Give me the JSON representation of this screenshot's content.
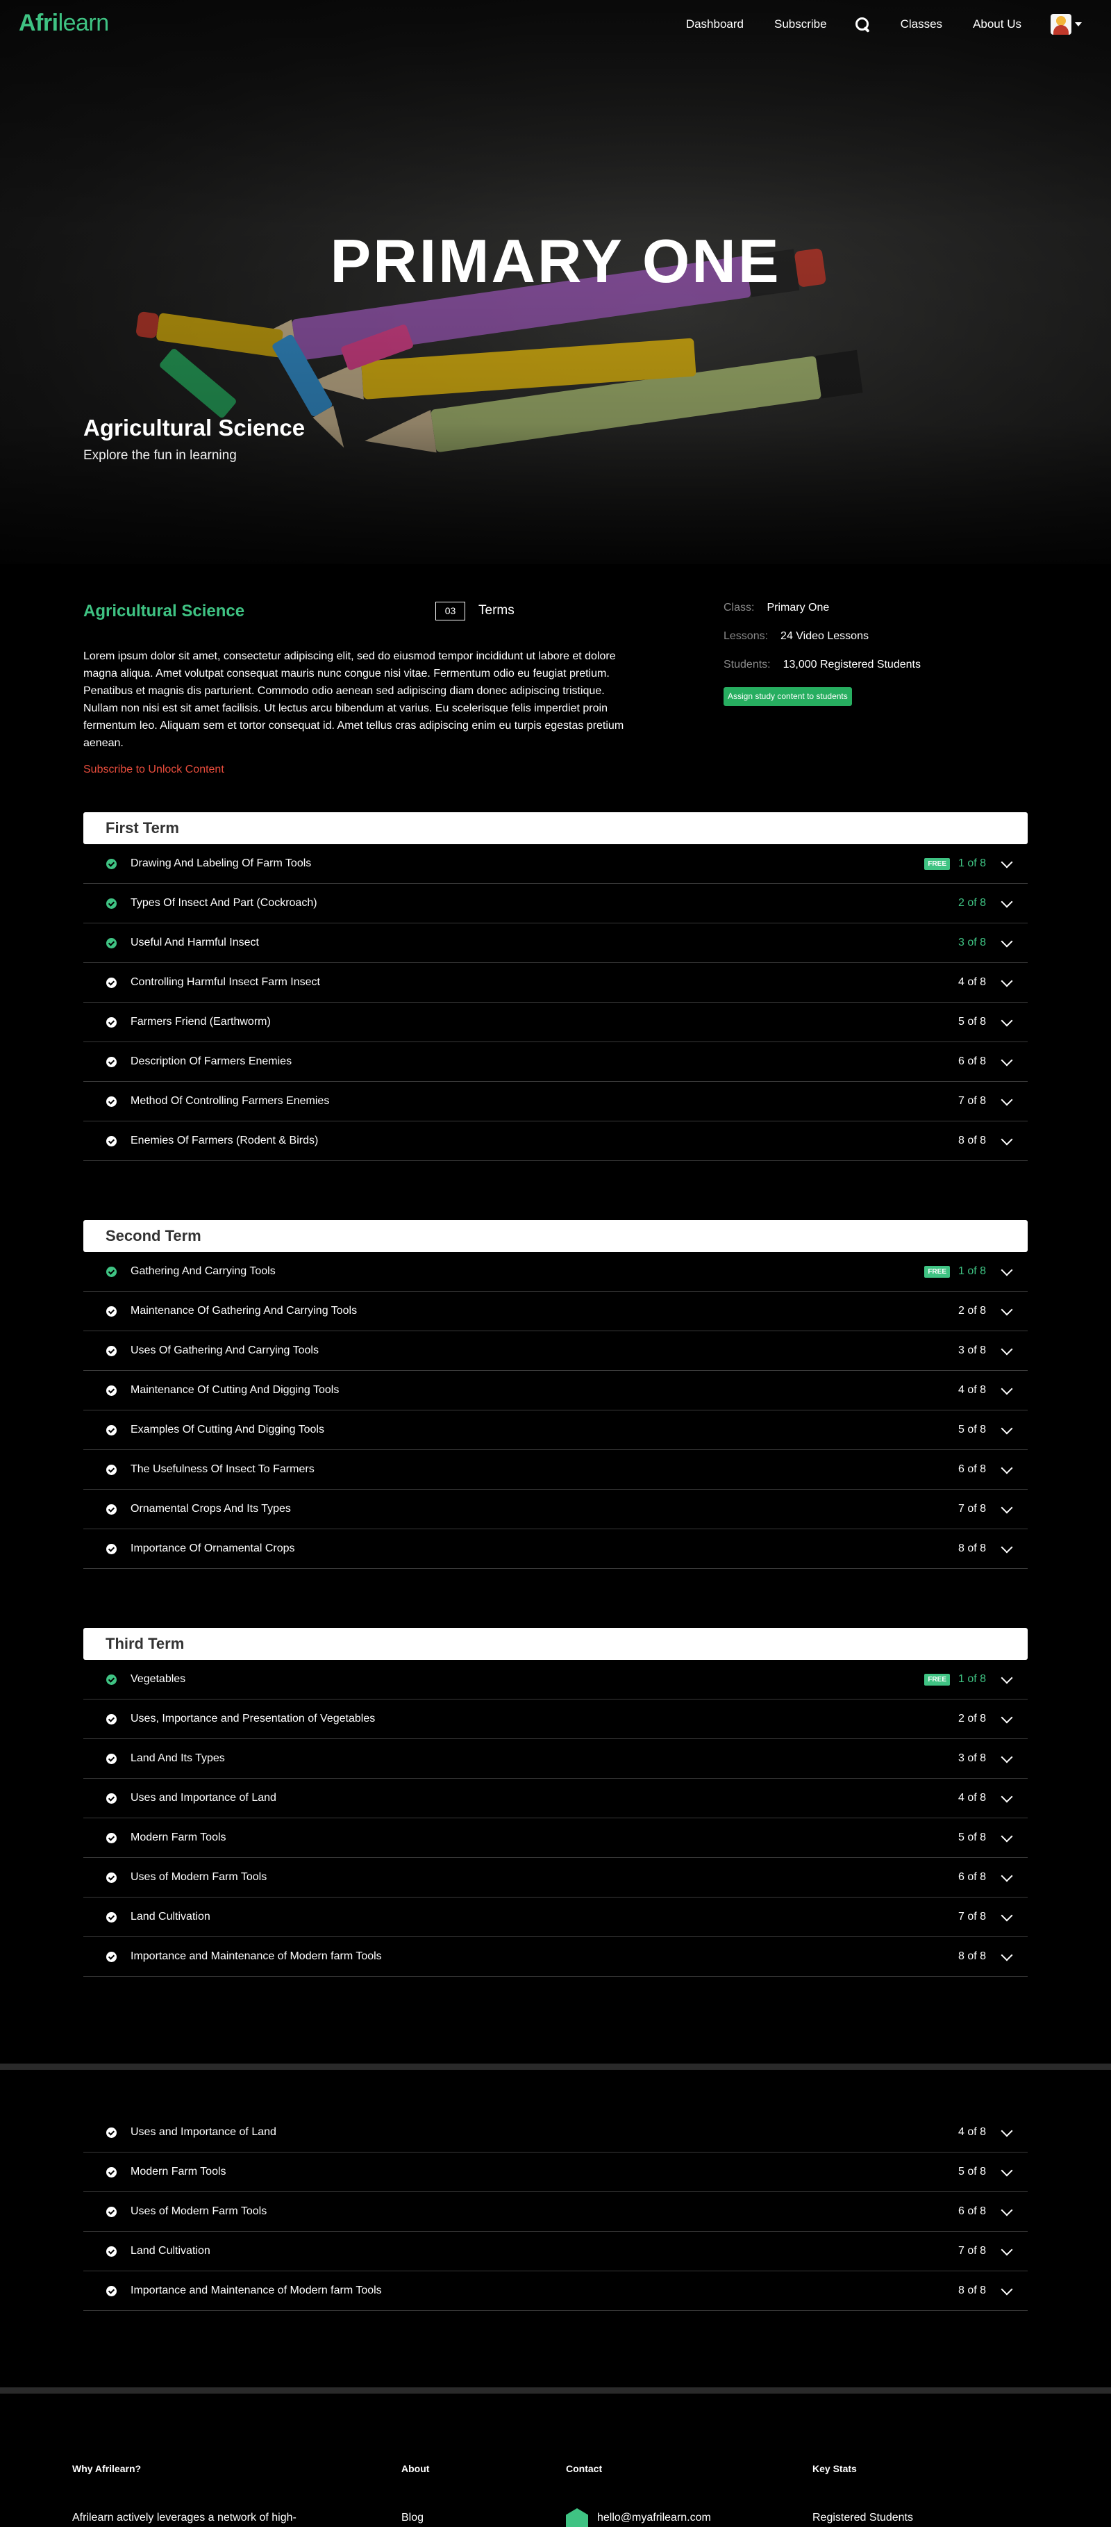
{
  "nav": {
    "logo_bold": "Afri",
    "logo_light": "learn",
    "links": [
      "Dashboard",
      "Subscribe",
      "Classes",
      "About Us"
    ]
  },
  "hero": {
    "title": "PRIMARY ONE",
    "subject": "Agricultural Science",
    "tagline": "Explore the fun in learning"
  },
  "info": {
    "subject_title": "Agricultural Science",
    "terms_count": "03",
    "terms_label": "Terms",
    "description": "Lorem ipsum dolor sit amet, consectetur adipiscing elit, sed do eiusmod tempor incididunt ut labore et dolore magna aliqua. Amet volutpat consequat mauris nunc congue nisi vitae. Fermentum odio eu feugiat pretium. Penatibus et magnis dis parturient. Commodo odio aenean sed adipiscing diam donec adipiscing tristique. Nullam non nisi est sit amet facilisis. Ut lectus arcu bibendum at varius. Eu scelerisque felis imperdiet proin fermentum leo. Aliquam sem et tortor consequat id. Amet tellus cras adipiscing enim eu turpis egestas pretium aenean.",
    "subscribe_link": "Subscribe to Unlock Content",
    "class_label": "Class:",
    "class_value": "Primary One",
    "lessons_label": "Lessons:",
    "lessons_value": "24 Video Lessons",
    "students_label": "Students:",
    "students_value": "13,000 Registered Students",
    "assign_button": "Assign study content to students"
  },
  "colors": {
    "accent": "#3fc383",
    "warning": "#e74c3c",
    "background": "#000000"
  },
  "badge_text": "FREE",
  "terms": [
    {
      "name": "First Term",
      "lessons": [
        {
          "title": "Drawing And Labeling Of Farm Tools",
          "count": "1 of 8",
          "free": true,
          "unlocked": true
        },
        {
          "title": "Types Of Insect And Part (Cockroach)",
          "count": "2 of 8",
          "free": false,
          "unlocked": true
        },
        {
          "title": "Useful And Harmful Insect",
          "count": "3 of 8",
          "free": false,
          "unlocked": true
        },
        {
          "title": "Controlling Harmful Insect Farm Insect",
          "count": "4 of 8",
          "free": false,
          "unlocked": false
        },
        {
          "title": "Farmers Friend (Earthworm)",
          "count": "5 of 8",
          "free": false,
          "unlocked": false
        },
        {
          "title": "Description Of Farmers Enemies",
          "count": "6 of 8",
          "free": false,
          "unlocked": false
        },
        {
          "title": "Method Of Controlling Farmers Enemies",
          "count": "7 of 8",
          "free": false,
          "unlocked": false
        },
        {
          "title": "Enemies Of Farmers (Rodent & Birds)",
          "count": "8 of 8",
          "free": false,
          "unlocked": false
        }
      ]
    },
    {
      "name": "Second Term",
      "lessons": [
        {
          "title": "Gathering And Carrying Tools",
          "count": "1 of 8",
          "free": true,
          "unlocked": true
        },
        {
          "title": "Maintenance Of Gathering And Carrying Tools",
          "count": "2 of 8",
          "free": false,
          "unlocked": false
        },
        {
          "title": "Uses Of Gathering And Carrying Tools",
          "count": "3 of 8",
          "free": false,
          "unlocked": false
        },
        {
          "title": "Maintenance Of Cutting And Digging Tools",
          "count": "4 of 8",
          "free": false,
          "unlocked": false
        },
        {
          "title": "Examples Of Cutting And Digging Tools",
          "count": "5 of 8",
          "free": false,
          "unlocked": false
        },
        {
          "title": "The Usefulness Of Insect To Farmers",
          "count": "6 of 8",
          "free": false,
          "unlocked": false
        },
        {
          "title": "Ornamental Crops And Its Types",
          "count": "7 of 8",
          "free": false,
          "unlocked": false
        },
        {
          "title": "Importance Of Ornamental Crops",
          "count": "8 of 8",
          "free": false,
          "unlocked": false
        }
      ]
    },
    {
      "name": "Third Term",
      "lessons": [
        {
          "title": "Vegetables",
          "count": "1 of 8",
          "free": true,
          "unlocked": true
        },
        {
          "title": "Uses, Importance and Presentation of Vegetables",
          "count": "2 of 8",
          "free": false,
          "unlocked": false
        },
        {
          "title": "Land And Its Types",
          "count": "3 of 8",
          "free": false,
          "unlocked": false
        },
        {
          "title": "Uses and Importance of Land",
          "count": "4 of 8",
          "free": false,
          "unlocked": false
        },
        {
          "title": "Modern Farm Tools",
          "count": "5 of 8",
          "free": false,
          "unlocked": false
        },
        {
          "title": "Uses of Modern Farm Tools",
          "count": "6 of 8",
          "free": false,
          "unlocked": false
        },
        {
          "title": "Land Cultivation",
          "count": "7 of 8",
          "free": false,
          "unlocked": false
        },
        {
          "title": "Importance and Maintenance of Modern farm Tools",
          "count": "8 of 8",
          "free": false,
          "unlocked": false
        }
      ]
    }
  ],
  "extra_lessons": [
    {
      "title": "Uses and Importance of Land",
      "count": "4 of 8"
    },
    {
      "title": "Modern Farm Tools",
      "count": "5 of 8"
    },
    {
      "title": "Uses of Modern Farm Tools",
      "count": "6 of 8"
    },
    {
      "title": "Land Cultivation",
      "count": "7 of 8"
    },
    {
      "title": "Importance and Maintenance of Modern farm Tools",
      "count": "8 of 8"
    }
  ],
  "footer": {
    "why_heading": "Why Afrilearn?",
    "why_text": "Afrilearn actively leverages a network of high-",
    "about_heading": "About",
    "about_link": "Blog",
    "contact_heading": "Contact",
    "contact_email": "hello@myafrilearn.com",
    "stats_heading": "Key Stats",
    "stats_link": "Registered Students"
  }
}
